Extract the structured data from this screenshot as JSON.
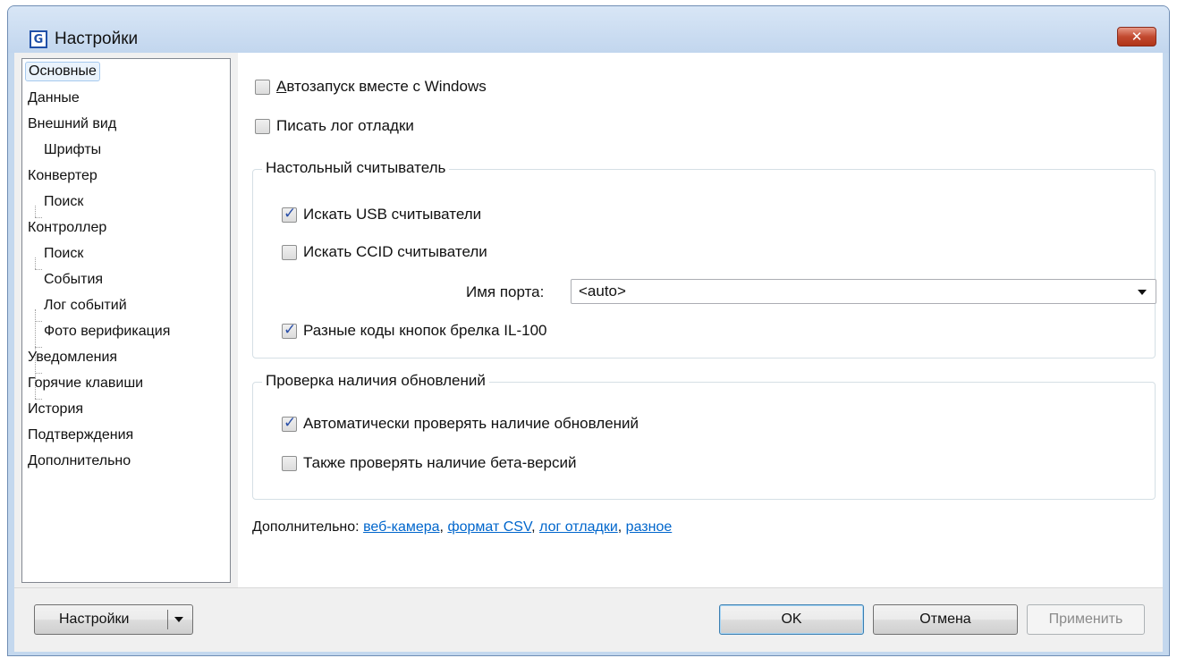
{
  "window": {
    "title": "Настройки",
    "app_icon": "app-logo-icon",
    "close_glyph": "✕"
  },
  "tree": {
    "items": [
      {
        "label": "Основные",
        "level": 0,
        "selected": true
      },
      {
        "label": "Данные",
        "level": 0
      },
      {
        "label": "Внешний вид",
        "level": 0
      },
      {
        "label": "Шрифты",
        "level": 1
      },
      {
        "label": "Конвертер",
        "level": 0
      },
      {
        "label": "Поиск",
        "level": 1
      },
      {
        "label": "Контроллер",
        "level": 0
      },
      {
        "label": "Поиск",
        "level": 1
      },
      {
        "label": "События",
        "level": 1
      },
      {
        "label": "Лог событий",
        "level": 1
      },
      {
        "label": "Фото верификация",
        "level": 1
      },
      {
        "label": "Уведомления",
        "level": 0
      },
      {
        "label": "Горячие клавиши",
        "level": 0
      },
      {
        "label": "История",
        "level": 0
      },
      {
        "label": "Подтверждения",
        "level": 0
      },
      {
        "label": "Дополнительно",
        "level": 0
      }
    ]
  },
  "general": {
    "autostart": {
      "accel": "А",
      "rest": "втозапуск вместе с Windows",
      "checked": false
    },
    "debug_log": {
      "label": "Писать лог отладки",
      "checked": false
    }
  },
  "desktop_reader": {
    "title": "Настольный считыватель",
    "usb": {
      "label": "Искать USB считыватели",
      "checked": true
    },
    "ccid": {
      "label": "Искать CCID считыватели",
      "checked": false
    },
    "port_label": "Имя порта:",
    "port_value": "<auto>",
    "keyfob": {
      "label": "Разные коды кнопок брелка IL-100",
      "checked": true
    }
  },
  "updates": {
    "title": "Проверка наличия обновлений",
    "auto": {
      "label": "Автоматически проверять наличие обновлений",
      "checked": true
    },
    "beta": {
      "label": "Также проверять наличие бета-версий",
      "checked": false
    }
  },
  "more": {
    "label": "Дополнительно:",
    "links": [
      "веб-камера",
      "формат CSV",
      "лог отладки",
      "разное"
    ],
    "separator": ", "
  },
  "footer": {
    "settings_button": "Настройки",
    "ok_button": "OK",
    "cancel_button": "Отмена",
    "apply_button": "Применить"
  }
}
